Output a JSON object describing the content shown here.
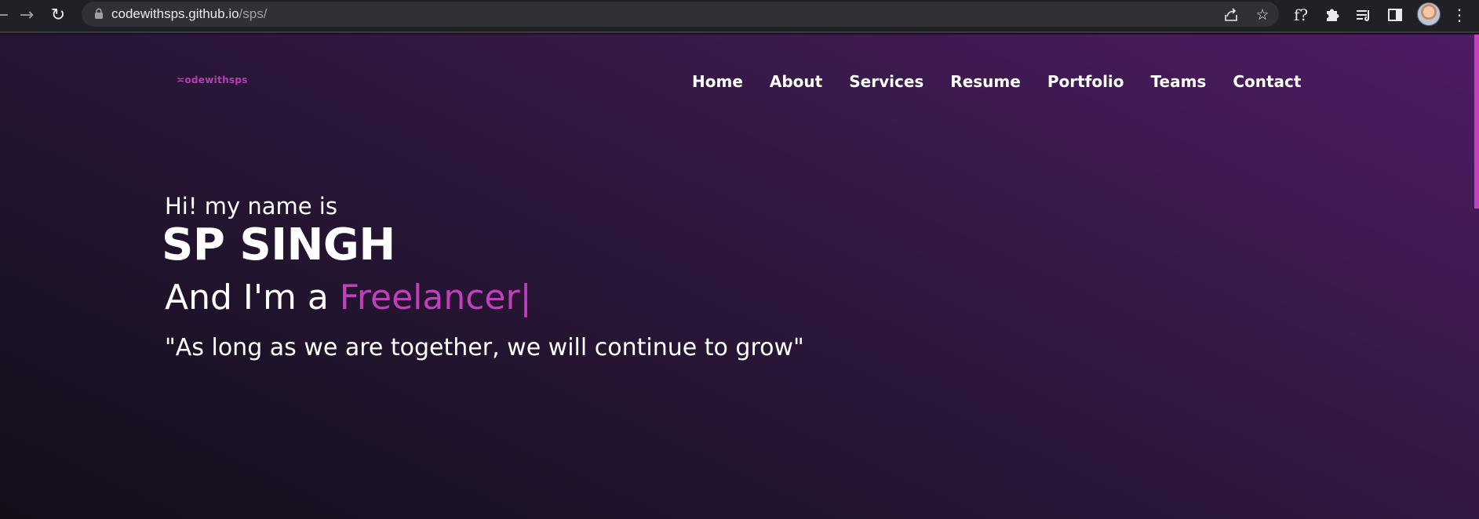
{
  "browser": {
    "url_host": "codewithsps.github.io",
    "url_path": "/sps/",
    "icons": {
      "back": "back-arrow-icon",
      "forward": "forward-arrow-icon",
      "reload": "reload-icon",
      "lock": "lock-icon",
      "share": "share-icon",
      "bookmark": "star-icon",
      "extension_fx": "f?",
      "extensions": "puzzle-icon",
      "media": "media-queue-icon",
      "side_panel": "side-panel-icon",
      "menu": "kebab-menu-icon"
    }
  },
  "site": {
    "logo": "odewithsps",
    "nav": [
      "Home",
      "About",
      "Services",
      "Resume",
      "Portfolio",
      "Teams",
      "Contact"
    ],
    "hero": {
      "greeting": "Hi! my name is",
      "name": "SP SINGH",
      "role_prefix": "And I'm a ",
      "role_typed": "Freelancer",
      "caret": "|",
      "quote": "\"As long as we are together, we will continue to grow\""
    },
    "colors": {
      "accent": "#c13fbd",
      "background_dark": "#140e1a",
      "background_purple": "#4f1a63"
    }
  }
}
